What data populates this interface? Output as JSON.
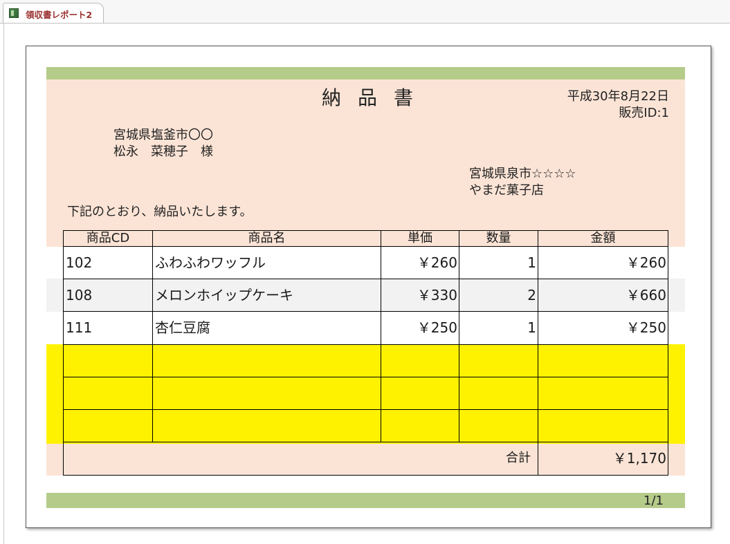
{
  "tab": {
    "title": "領収書レポート2"
  },
  "report": {
    "title": "納品書",
    "date": "平成30年8月22日",
    "sales_id": "販売ID:1",
    "customer": {
      "address": "宮城県塩釜市〇〇",
      "name": "松永　菜穂子　様"
    },
    "store": {
      "address": "宮城県泉市☆☆☆☆",
      "name": "やまだ菓子店"
    },
    "message": "下記のとおり、納品いたします。",
    "columns": [
      "商品CD",
      "商品名",
      "単価",
      "数量",
      "金額"
    ],
    "rows": [
      {
        "cd": "102",
        "name": "ふわふわワッフル",
        "price": "￥260",
        "qty": "1",
        "amount": "￥260"
      },
      {
        "cd": "108",
        "name": "メロンホイップケーキ",
        "price": "￥330",
        "qty": "2",
        "amount": "￥660"
      },
      {
        "cd": "111",
        "name": "杏仁豆腐",
        "price": "￥250",
        "qty": "1",
        "amount": "￥250"
      }
    ],
    "total_label": "合計",
    "total_value": "￥1,170",
    "page_number": "1/1"
  },
  "colors": {
    "band_green": "#b5cb8a",
    "header_peach": "#fbe4d6",
    "alt_row_gray": "#f2f2f2",
    "empty_row_yellow": "#fff200",
    "tab_text": "#9b3030"
  }
}
